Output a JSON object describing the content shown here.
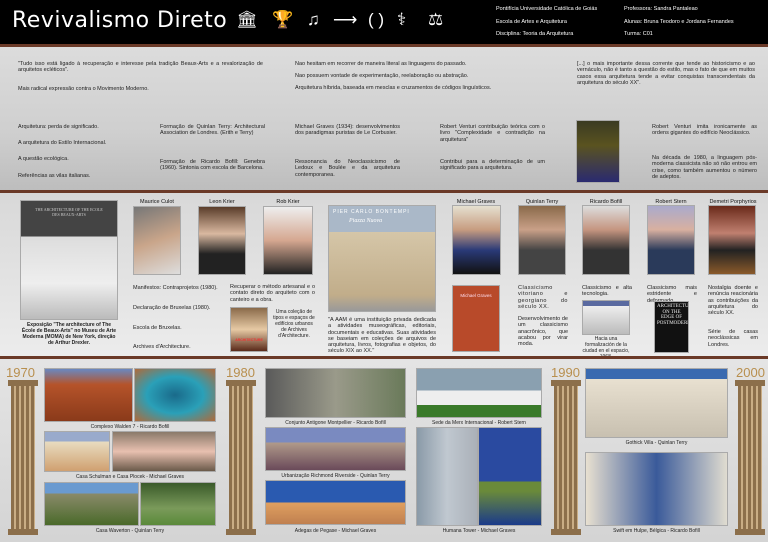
{
  "header": {
    "title": "Revivalismo Direto",
    "icons": [
      "temple-icon",
      "trophy-icon",
      "lyre-icon",
      "arrow-icon",
      "laurel-icon",
      "caduceus-icon",
      "scales-icon"
    ],
    "institution": "Pontifícia Universidade Católica de Goiás",
    "school": "Escola de Artes e Arquitetura",
    "discipline": "Disciplina: Teoria da Arquitetura",
    "professor": "Professora: Sandra Pantaleao",
    "students": "Alunas: Bruna Teodoro e Jordana Fernandes",
    "class": "Turma: C01"
  },
  "top": {
    "quote1": "\"Tudo isso está ligado à recuperação e interesse pela tradição Beaux-Arts e a revalorização de arquitetos ecléticos\".",
    "radical": "Mais radical expressão contra o Movimento Moderno.",
    "no_hesitation": "Nao hesitam em recorrer de maneira literal as linguagens do passado.",
    "no_will": "Nao possuem vontade de experimentação, reelaboração ou abstração.",
    "hybrid": "Arquitetura híbrida, baseada em mesclas e cruzamentos de códigos linguísticos.",
    "quote2": "[...] o mais importante dessa corrente que tende ao historicismo e ao vernáculo, não é tanto a questão do estilo, mas o fato de que em muitos casos essa arquitetura tende a evitar conquistas transcendentais da arquitetura do século XX\".",
    "list": [
      "Arquitetura: perda de significado.",
      "A arquitetura do Estilo Internacional.",
      "A questão ecológica.",
      "Referências as vilas italianas."
    ],
    "terry": "Formação de Quinlan Terry: Architectural Association de Londres. (Erith e Terry)",
    "bofill": "Formação de Ricardo Bofill: Genebra (1960). Sintonia com escola de Barcelona.",
    "graves": "Michael Graves (1934): desenvolvimentos dos paradigmas puristas de Le Corbusier.",
    "resonance": "Ressonancia do Neoclassicismo de Ledoux e Boulée e da arquitetura contemporanea.",
    "venturi1": "Robert Venturi contribuição teórica com o livro \"Complexidade e contradição na arquitetura\"",
    "contrib": "Contribui para a determinação de um significado para a arquitetura.",
    "venturi2": "Robert Venturi imita ironicamente as ordens gigantes do edifício Neoclássico.",
    "decade": "Na década de 1980, a linguagem pós-moderna classicista não só não entrou em crise, como também aumentou o número de adeptos."
  },
  "middle": {
    "expo_caption": "Exposição \"The architecture of The École de Beaux-Arts\" no Museu de Arte Moderna (MOMA) de New York, direção de Arthur Drexler.",
    "expo_sign": "THE ARCHITECTURE OF THE ECOLE DES BEAUX-ARTS",
    "people": [
      "Maurice Culot",
      "Leon Krier",
      "Rob Krier",
      "Michael Graves",
      "Quinlan Terry",
      "Ricardo Bofill",
      "Robert Stern",
      "Demetri Porphyrios"
    ],
    "culot_items": [
      "Manifestos: Contraprojetos (1980).",
      "Declaração de Bruxelas (1980).",
      "Escola de Bruxelas.",
      "Archives d'Architecture."
    ],
    "krier_text": "Recuperar o método artesanal e o contato direto do arquiteto com o canteiro e a obra.",
    "archives_text": "Uma coleção de tipos e espaços de edifícios urbanos de Archives d'Architecture.",
    "book_architecture": "ARCHITECTURE",
    "piazza_title": "PIER CARLO BONTEMPI",
    "piazza_sub": "Piazza Nuova",
    "aam_caption": "\"A AAM é uma instituição privada dedicada a atividades museográficas, editoriais, documentais e educativas. Suas atividades se baseiam em coleções de arquivos de arquitetura, livros, fotografias e objetos, do século XIX ao XX.\"",
    "graves_book": "Michael Graves",
    "terry_text1": "Classicismo vitoriano e georgiano do século XX.",
    "terry_text2": "Desenvolvimento de um classicismo anacrônico, que acabou por virar moda.",
    "bofill_text": "Classicismo e alta tecnologia.",
    "bofill_img_caption": "Hacia una formalización de la ciudad en el espacio, 1968.",
    "stern_text": "Classicismo mais estridente e deformado.",
    "stern_book": "ARCHITECTURE ON THE EDGE OF POSTMODERNISM",
    "porphyrios_text1": "Nostalgia doente e renúncia reacionária as contribuições da arquitetura do século XX.",
    "porphyrios_text2": "Série de casas neoclássicas em Londres."
  },
  "timeline": {
    "years": [
      "1970",
      "1980",
      "1990",
      "2000"
    ],
    "captions": [
      "Complexo Walden 7 - Ricardo Bofill",
      "Casa Schulman e Casa Plocek - Michael Graves",
      "Casa Waverton - Quinlan Terry",
      "Conjunto Antigone Montpellier - Ricardo Bofill",
      "Urbanização Richmond Riverside - Quinlan Terry",
      "Adegas de Pegase - Michael Graves",
      "Sede da Merx Internacional - Robert Stern",
      "Humana Tower - Michael Graves",
      "Gothick Villa - Quinlan Terry",
      "Swift em Hulpe, Bélgica - Ricardo Bofill"
    ]
  },
  "colors": {
    "header": "#000000",
    "separator": "#6b3a28",
    "gold": "#b88f4e"
  }
}
